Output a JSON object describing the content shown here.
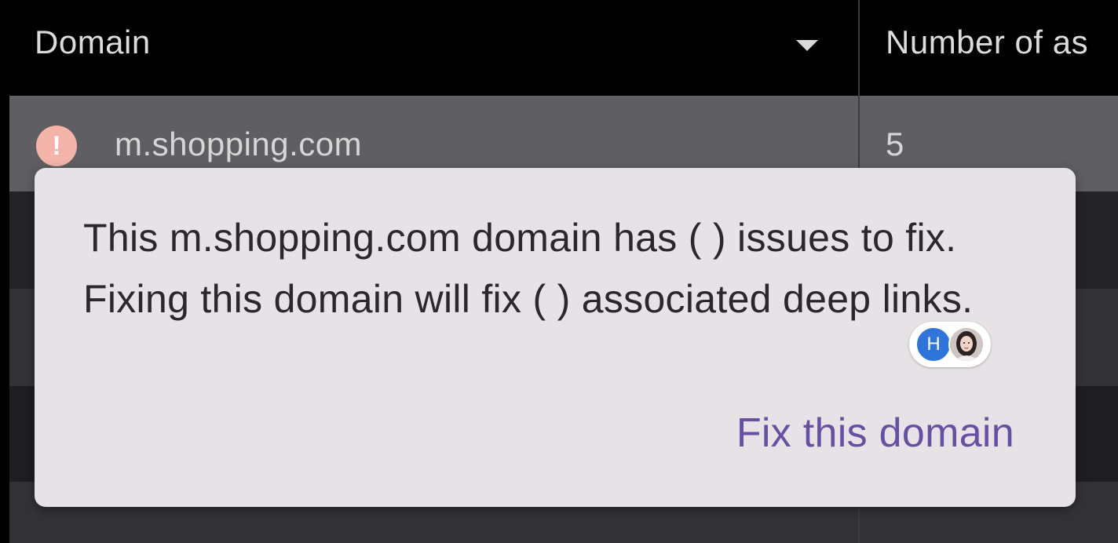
{
  "table": {
    "columns": [
      {
        "label": "Domain"
      },
      {
        "label": "Number of as"
      }
    ],
    "sort_icon": "sort-down-icon",
    "rows": [
      {
        "status_icon": "warning-icon",
        "status_glyph": "!",
        "domain": "m.shopping.com",
        "count": "5"
      }
    ]
  },
  "tooltip": {
    "message": "This m.shopping.com domain has ( ) issues to fix. Fixing this domain will fix ( ) associated deep links.",
    "action_label": "Fix this domain",
    "action_color": "#6750a4"
  },
  "collaborators": {
    "initial_avatar": "H",
    "initial_avatar_color": "#2f74d8",
    "photo_avatar": "user-photo-avatar"
  },
  "colors": {
    "warning_badge": "#f4b4aa",
    "selected_row": "#5f5f63",
    "tooltip_bg": "#e6e2e6"
  }
}
